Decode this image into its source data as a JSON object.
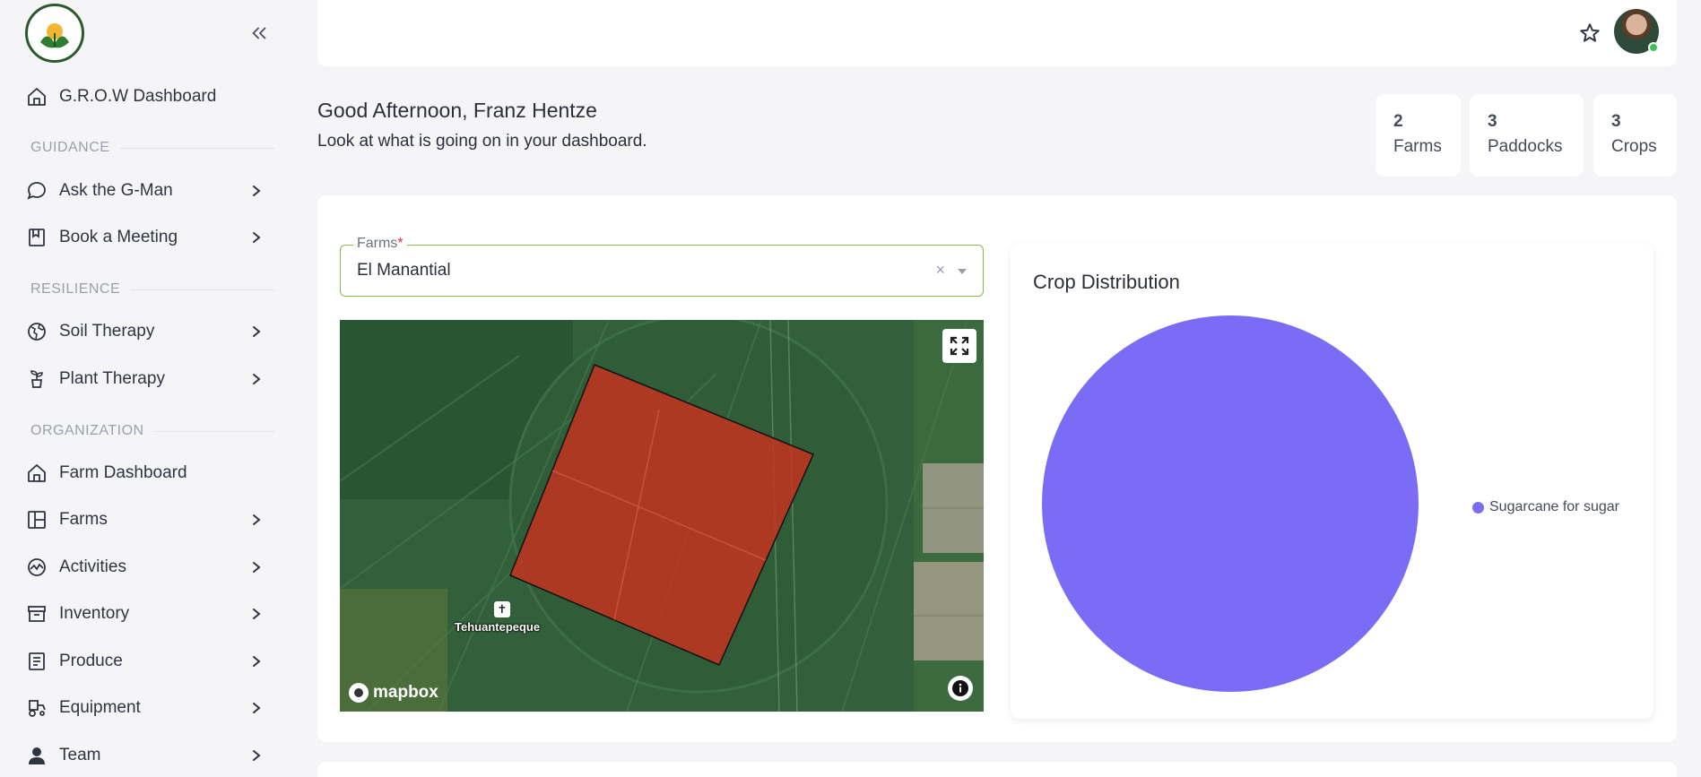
{
  "sidebar": {
    "logo_alt": "G.R.O.W Regeneration Farming",
    "items": {
      "dashboard": "G.R.O.W Dashboard",
      "ask": "Ask the G-Man",
      "meeting": "Book a Meeting",
      "soil": "Soil Therapy",
      "plant": "Plant Therapy",
      "farm_dashboard": "Farm Dashboard",
      "farms": "Farms",
      "activities": "Activities",
      "inventory": "Inventory",
      "produce": "Produce",
      "equipment": "Equipment",
      "team": "Team"
    },
    "sections": {
      "guidance": "GUIDANCE",
      "resilience": "RESILIENCE",
      "organization": "ORGANIZATION"
    }
  },
  "header": {
    "greeting": "Good Afternoon, Franz Hentze",
    "subtitle": "Look at what is going on in your dashboard."
  },
  "stats": [
    {
      "value": "2",
      "label": "Farms"
    },
    {
      "value": "3",
      "label": "Paddocks"
    },
    {
      "value": "3",
      "label": "Crops"
    }
  ],
  "farm_select": {
    "label": "Farms",
    "required_mark": "*",
    "value": "El Manantial",
    "clear": "×"
  },
  "map": {
    "place_label": "Tehuantepeque",
    "attribution": "mapbox"
  },
  "crop_distribution": {
    "title": "Crop Distribution"
  },
  "chart_data": {
    "type": "pie",
    "title": "Crop Distribution",
    "categories": [
      "Sugarcane for sugar"
    ],
    "values": [
      100
    ],
    "colors": [
      "#7b6cf6"
    ],
    "legend_position": "right"
  }
}
